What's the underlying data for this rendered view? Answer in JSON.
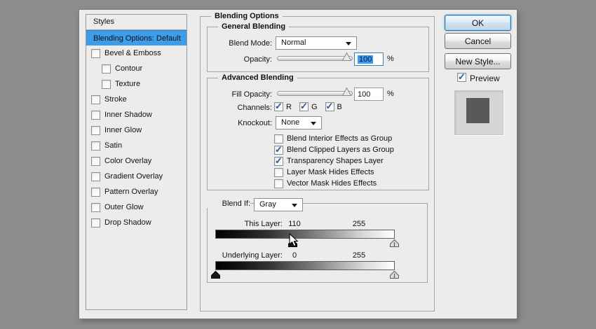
{
  "colors": {
    "desktop_bg": "#8c8c8c",
    "dialog_bg": "#ececec",
    "selection_blue": "#3f9ce6",
    "check_blue": "#2b5797",
    "swatch_gray": "#595959"
  },
  "sidebar": {
    "header": "Styles",
    "selected_item": "Blending Options: Default",
    "items": [
      {
        "label": "Bevel & Emboss",
        "checked": false,
        "indent": false
      },
      {
        "label": "Contour",
        "checked": false,
        "indent": true
      },
      {
        "label": "Texture",
        "checked": false,
        "indent": true
      },
      {
        "label": "Stroke",
        "checked": false,
        "indent": false
      },
      {
        "label": "Inner Shadow",
        "checked": false,
        "indent": false
      },
      {
        "label": "Inner Glow",
        "checked": false,
        "indent": false
      },
      {
        "label": "Satin",
        "checked": false,
        "indent": false
      },
      {
        "label": "Color Overlay",
        "checked": false,
        "indent": false
      },
      {
        "label": "Gradient Overlay",
        "checked": false,
        "indent": false
      },
      {
        "label": "Pattern Overlay",
        "checked": false,
        "indent": false
      },
      {
        "label": "Outer Glow",
        "checked": false,
        "indent": false
      },
      {
        "label": "Drop Shadow",
        "checked": false,
        "indent": false
      }
    ]
  },
  "main": {
    "title": "Blending Options",
    "general": {
      "legend": "General Blending",
      "blend_mode_label": "Blend Mode:",
      "blend_mode_value": "Normal",
      "opacity_label": "Opacity:",
      "opacity_value": "100",
      "opacity_unit": "%"
    },
    "advanced": {
      "legend": "Advanced Blending",
      "fill_opacity_label": "Fill Opacity:",
      "fill_opacity_value": "100",
      "fill_opacity_unit": "%",
      "channels_label": "Channels:",
      "channels": [
        {
          "label": "R",
          "checked": true
        },
        {
          "label": "G",
          "checked": true
        },
        {
          "label": "B",
          "checked": true
        }
      ],
      "knockout_label": "Knockout:",
      "knockout_value": "None",
      "options": [
        {
          "label": "Blend Interior Effects as Group",
          "checked": false
        },
        {
          "label": "Blend Clipped Layers as Group",
          "checked": true
        },
        {
          "label": "Transparency Shapes Layer",
          "checked": true
        },
        {
          "label": "Layer Mask Hides Effects",
          "checked": false
        },
        {
          "label": "Vector Mask Hides Effects",
          "checked": false
        }
      ]
    },
    "blend_if": {
      "label": "Blend If:",
      "value": "Gray",
      "this_layer_label": "This Layer:",
      "this_layer": {
        "low": 110,
        "high": 255
      },
      "this_layer_low_text": "110",
      "this_layer_high_text": "255",
      "underlying_label": "Underlying Layer:",
      "underlying": {
        "low": 0,
        "high": 255
      },
      "underlying_low_text": "0",
      "underlying_high_text": "255"
    }
  },
  "buttons": {
    "ok": "OK",
    "cancel": "Cancel",
    "new_style": "New Style...",
    "preview_label": "Preview",
    "preview_checked": true
  }
}
